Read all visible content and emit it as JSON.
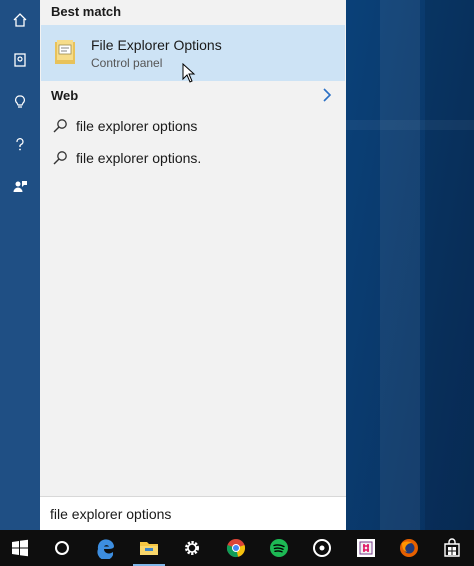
{
  "rail": {
    "items": [
      {
        "icon": "home-icon"
      },
      {
        "icon": "notebook-icon"
      },
      {
        "icon": "lightbulb-icon"
      },
      {
        "icon": "help-icon"
      },
      {
        "icon": "feedback-icon"
      }
    ]
  },
  "results": {
    "best_match_heading": "Best match",
    "best_match": {
      "title": "File Explorer Options",
      "subtitle": "Control panel",
      "icon": "folder-options-icon"
    },
    "web_heading": "Web",
    "web_items": [
      {
        "label": "file explorer options",
        "icon": "search-icon"
      },
      {
        "label": "file explorer options.",
        "icon": "search-icon"
      }
    ]
  },
  "search": {
    "value": "file explorer options"
  },
  "taskbar": {
    "items": [
      {
        "icon": "windows-start-icon"
      },
      {
        "icon": "cortana-icon"
      },
      {
        "icon": "edge-icon"
      },
      {
        "icon": "file-explorer-icon"
      },
      {
        "icon": "settings-gear-icon"
      },
      {
        "icon": "chrome-icon"
      },
      {
        "icon": "spotify-icon"
      },
      {
        "icon": "groove-music-icon"
      },
      {
        "icon": "slack-icon"
      },
      {
        "icon": "firefox-icon"
      },
      {
        "icon": "store-icon"
      }
    ]
  },
  "colors": {
    "accent": "#cde3f5",
    "rail": "#1f4f84",
    "taskbar": "#0e0e0e"
  }
}
